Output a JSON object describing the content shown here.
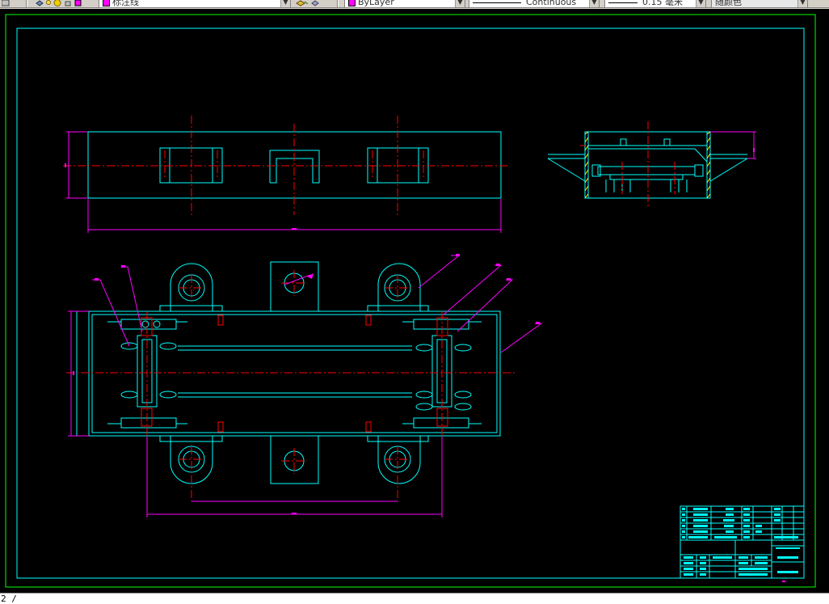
{
  "toolbar": {
    "layer_name": "标注线",
    "color_value": "ByLayer",
    "linetype_value": "Continuous",
    "lineweight_value": "0.15 毫米",
    "plotstyle_value": "随颜色"
  },
  "colors": {
    "background": "#000000",
    "outline": "#00ffff",
    "centerline": "#ff0000",
    "dimension": "#ff00ff",
    "frame_green": "#00ff00",
    "hatch": "#ffff00"
  },
  "icons": [
    "layer-manager-icon",
    "lightbulb-icon",
    "sun-icon",
    "lock-icon",
    "layer-color-icon",
    "layer-previous-icon",
    "layer-states-icon"
  ],
  "drawing": {
    "views": [
      "front-view",
      "side-view",
      "top-view"
    ],
    "title_block": "title-block"
  },
  "cmdline": {
    "text": "2 /"
  }
}
